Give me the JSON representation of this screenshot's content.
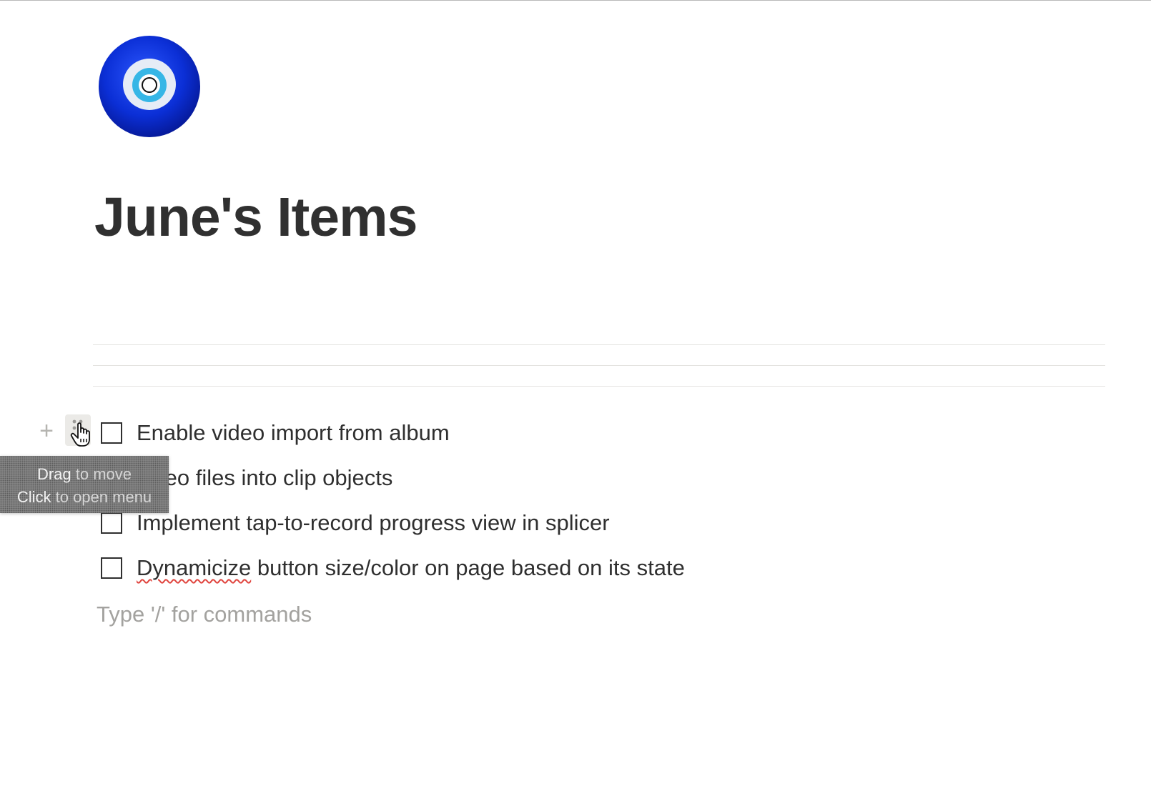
{
  "page": {
    "title": "June's Items",
    "icon": "nazar-evil-eye-icon"
  },
  "toolbar": {
    "add_block_icon": "plus-icon",
    "drag_handle_icon": "drag-handle-dots-icon"
  },
  "tooltip": {
    "line1_strong": "Drag",
    "line1_rest": " to move",
    "line2_strong": "Click",
    "line2_rest": " to open menu"
  },
  "todos": [
    {
      "text": "Enable video import from album",
      "checked": false
    },
    {
      "text": "video files into clip objects",
      "checked": false
    },
    {
      "text": "Implement tap-to-record progress view in splicer",
      "checked": false
    },
    {
      "text_misspelled": "Dynamicize",
      "text_rest": " button size/color on page based on its state",
      "checked": false
    }
  ],
  "editor": {
    "placeholder": "Type '/' for commands"
  },
  "colors": {
    "text": "#2f2f2f",
    "placeholder": "#a3a29f",
    "divider": "#e4e3e0",
    "icon_blue": "#0a2fd0",
    "icon_cyan": "#36b6e6"
  }
}
